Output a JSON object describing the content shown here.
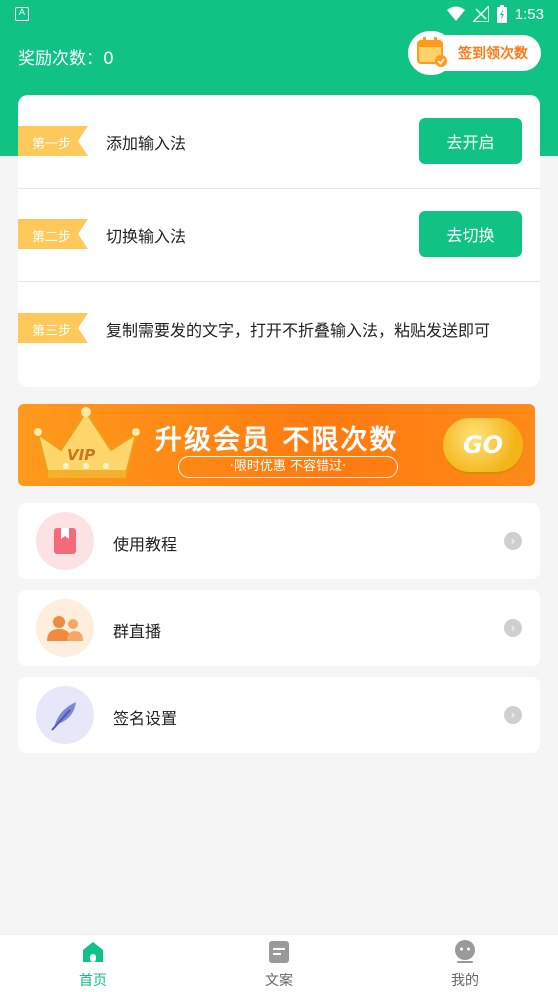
{
  "status_bar": {
    "time": "1:53",
    "notification_icon": "A"
  },
  "header": {
    "reward_label": "奖励次数：0",
    "signin_button": "签到领次数"
  },
  "steps": [
    {
      "tag": "第一步",
      "text": "添加输入法",
      "button": "去开启"
    },
    {
      "tag": "第二步",
      "text": "切换输入法",
      "button": "去切换"
    },
    {
      "tag": "第三步",
      "text": "复制需要发的文字，打开不折叠输入法，粘贴发送即可"
    }
  ],
  "banner": {
    "badge": "VIP",
    "title": "升级会员 不限次数",
    "subtitle": "·限时优惠  不容错过·",
    "go": "GO"
  },
  "menu": [
    {
      "label": "使用教程",
      "icon": "bookmark-icon",
      "color": "#fde2e4"
    },
    {
      "label": "群直播",
      "icon": "group-icon",
      "color": "#fdeedd"
    },
    {
      "label": "签名设置",
      "icon": "feather-icon",
      "color": "#e6e8fa"
    }
  ],
  "tabbar": [
    {
      "label": "首页",
      "icon": "home-icon",
      "active": true
    },
    {
      "label": "文案",
      "icon": "document-icon",
      "active": false
    },
    {
      "label": "我的",
      "icon": "profile-icon",
      "active": false
    }
  ],
  "colors": {
    "accent": "#10c385",
    "tag": "#ffc85a",
    "orange": "#ff7a1a"
  }
}
